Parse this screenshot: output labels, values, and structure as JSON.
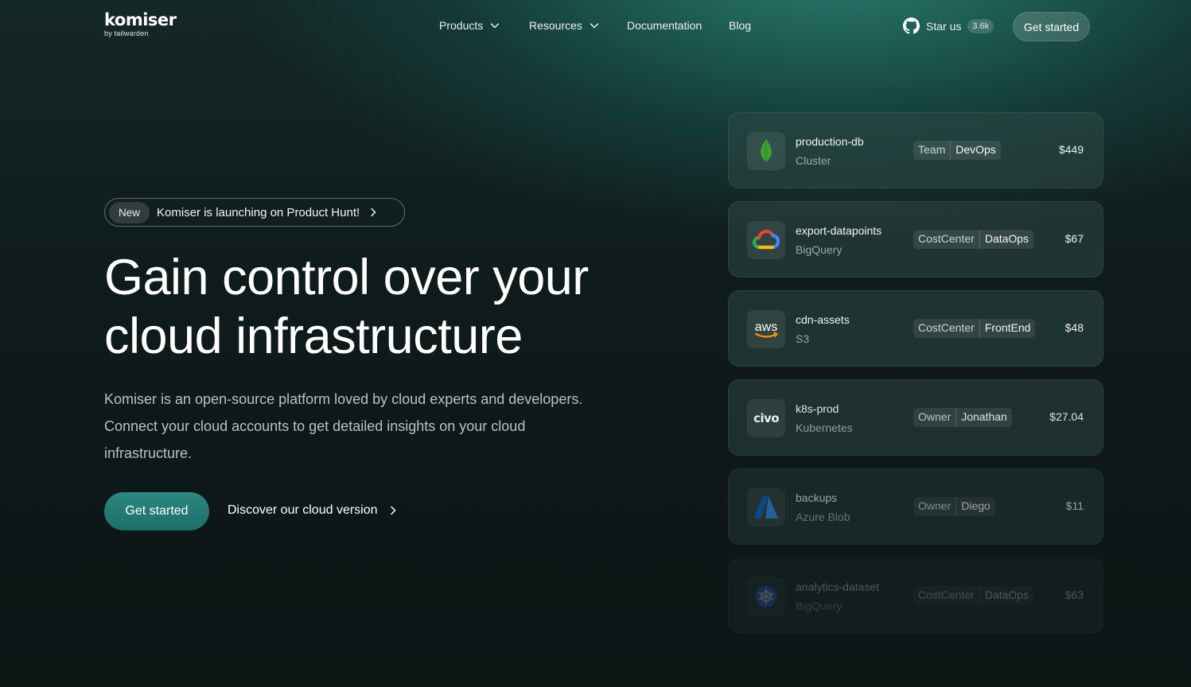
{
  "brand": {
    "name": "komiser",
    "byline": "by tailwarden"
  },
  "nav": {
    "links": [
      {
        "label": "Products",
        "has_dropdown": true
      },
      {
        "label": "Resources",
        "has_dropdown": true
      },
      {
        "label": "Documentation"
      },
      {
        "label": "Blog"
      }
    ],
    "github": {
      "label": "Star us",
      "count": "3.6k",
      "icon": "github-icon"
    },
    "cta_label": "Get started"
  },
  "hero": {
    "announcement": {
      "badge": "New",
      "text": "Komiser is launching on Product Hunt!"
    },
    "headline_line1": "Gain control over your",
    "headline_line2": "cloud infrastructure",
    "description": "Komiser is an open-source platform loved by cloud experts and developers. Connect your cloud accounts to get detailed insights on your cloud infrastructure.",
    "primary_cta": "Get started",
    "secondary_cta": "Discover our cloud version"
  },
  "resources": [
    {
      "name": "production-db",
      "type": "Cluster",
      "tag_key": "Team",
      "tag_value": "DevOps",
      "cost": "$449",
      "icon": "mongodb-icon"
    },
    {
      "name": "export-datapoints",
      "type": "BigQuery",
      "tag_key": "CostCenter",
      "tag_value": "DataOps",
      "cost": "$67",
      "icon": "google-cloud-icon"
    },
    {
      "name": "cdn-assets",
      "type": "S3",
      "tag_key": "CostCenter",
      "tag_value": "FrontEnd",
      "cost": "$48",
      "icon": "aws-icon"
    },
    {
      "name": "k8s-prod",
      "type": "Kubernetes",
      "tag_key": "Owner",
      "tag_value": "Jonathan",
      "cost": "$27.04",
      "icon": "civo-icon"
    },
    {
      "name": "backups",
      "type": "Azure Blob",
      "tag_key": "Owner",
      "tag_value": "Diego",
      "cost": "$11",
      "icon": "azure-icon"
    },
    {
      "name": "analytics-dataset",
      "type": "BigQuery",
      "tag_key": "CostCenter",
      "tag_value": "DataOps",
      "cost": "$63",
      "icon": "kubernetes-icon"
    }
  ],
  "icon_texts": {
    "aws": "aws",
    "civo": "civo"
  },
  "colors": {
    "accent": "#24786f",
    "background": "#0f1a1a"
  }
}
